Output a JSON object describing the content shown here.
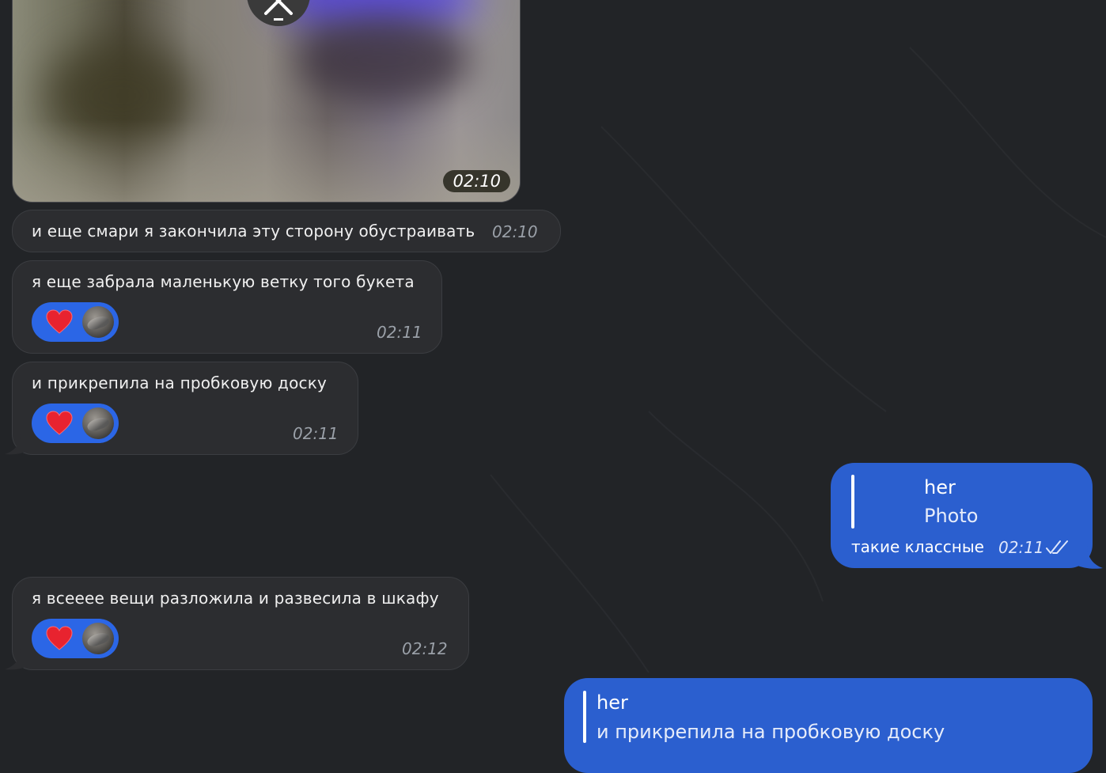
{
  "media_message": {
    "time": "02:10"
  },
  "messages_in": [
    {
      "text": "и еще смари я закончила эту сторону обустраивать",
      "time": "02:10"
    },
    {
      "text": "я еще забрала маленькую ветку того букета",
      "time": "02:11",
      "reaction": "heart-icon"
    },
    {
      "text": "и прикрепила на пробковую доску",
      "time": "02:11",
      "reaction": "heart-icon"
    },
    {
      "text": "я всееее вещи разложила и развесила в шкафу",
      "time": "02:12",
      "reaction": "heart-icon"
    }
  ],
  "messages_out": [
    {
      "reply_name": "her",
      "reply_text": "Photo",
      "text": "такие классные",
      "time": "02:11"
    },
    {
      "reply_name": "her",
      "reply_text": "и прикрепила на пробковую доску"
    }
  ],
  "colors": {
    "background": "#222427",
    "incoming_bubble": "#2c2d30",
    "outgoing_bubble": "#2b5fcf",
    "reaction_pill": "#2b66e6"
  }
}
